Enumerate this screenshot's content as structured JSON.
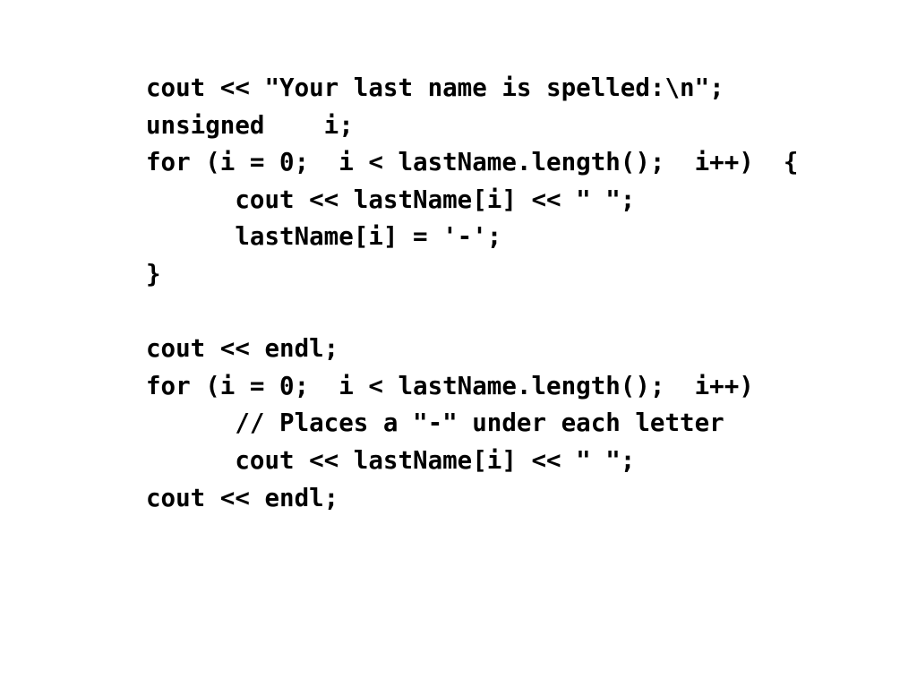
{
  "slide": {
    "background_color": "#ffffff",
    "text_color": "#000000",
    "language": "cpp",
    "code_lines": [
      {
        "id": "line-1",
        "text": "cout << \"Your last name is spelled:\\n\";",
        "indent": 0,
        "blank": false
      },
      {
        "id": "line-2",
        "text": "unsigned    i;",
        "indent": 0,
        "blank": false
      },
      {
        "id": "line-3",
        "text": "for (i = 0;  i < lastName.length();  i++)  {",
        "indent": 0,
        "blank": false
      },
      {
        "id": "line-4",
        "text": "      cout << lastName[i] << \" \";",
        "indent": 6,
        "blank": false
      },
      {
        "id": "line-5",
        "text": "      lastName[i] = '-';",
        "indent": 6,
        "blank": false
      },
      {
        "id": "line-6",
        "text": "}",
        "indent": 0,
        "blank": false
      },
      {
        "id": "line-7",
        "text": "",
        "indent": 0,
        "blank": true
      },
      {
        "id": "line-8",
        "text": "cout << endl;",
        "indent": 0,
        "blank": false
      },
      {
        "id": "line-9",
        "text": "for (i = 0;  i < lastName.length();  i++)",
        "indent": 0,
        "blank": false
      },
      {
        "id": "line-10",
        "text": "      // Places a \"-\" under each letter",
        "indent": 6,
        "blank": false
      },
      {
        "id": "line-11",
        "text": "      cout << lastName[i] << \" \";",
        "indent": 6,
        "blank": false
      },
      {
        "id": "line-12",
        "text": "cout << endl;",
        "indent": 0,
        "blank": false
      }
    ]
  }
}
